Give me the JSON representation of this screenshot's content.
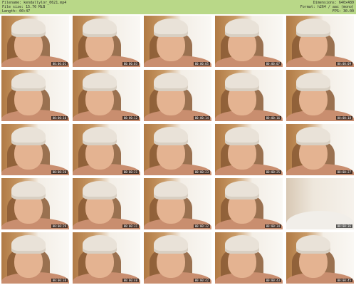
{
  "header": {
    "left": [
      "Filename: kendallylor_0621.mp4",
      "File size: 15.70 MiB",
      "Length: 00:47"
    ],
    "right": [
      "Dimensions: 640x480",
      "Format: h264 / aac (mono)",
      "FPS: 30.00"
    ]
  },
  "thumbnails": [
    {
      "time": "00:00:01"
    },
    {
      "time": "00:00:03"
    },
    {
      "time": "00:00:05"
    },
    {
      "time": "00:00:07"
    },
    {
      "time": "00:00:09"
    },
    {
      "time": "00:00:10"
    },
    {
      "time": "00:00:12"
    },
    {
      "time": "00:00:14"
    },
    {
      "time": "00:00:16"
    },
    {
      "time": "00:00:18"
    },
    {
      "time": "00:00:20"
    },
    {
      "time": "00:00:21"
    },
    {
      "time": "00:00:23"
    },
    {
      "time": "00:00:25"
    },
    {
      "time": "00:00:27"
    },
    {
      "time": "00:00:29"
    },
    {
      "time": "00:00:31"
    },
    {
      "time": "00:00:32"
    },
    {
      "time": "00:00:34"
    },
    {
      "time": "00:00:36"
    },
    {
      "time": "00:00:38"
    },
    {
      "time": "00:00:40"
    },
    {
      "time": "00:00:42"
    },
    {
      "time": "00:00:43"
    },
    {
      "time": "00:00:45"
    }
  ]
}
